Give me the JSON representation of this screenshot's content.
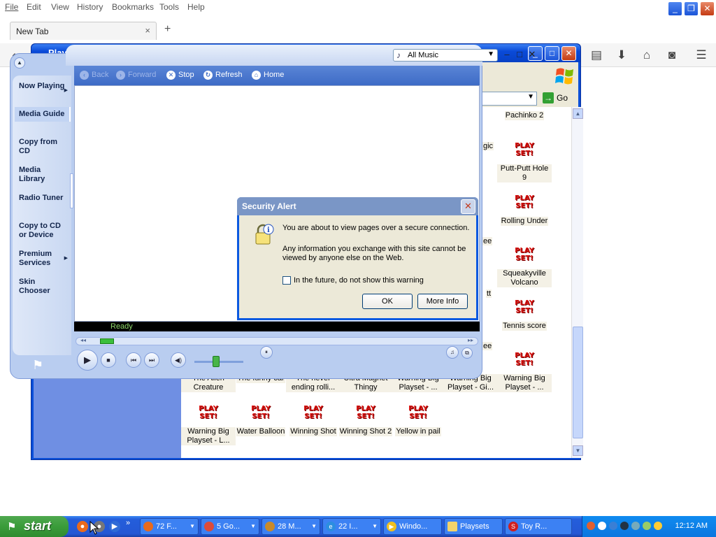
{
  "firefox": {
    "menu": [
      "File",
      "Edit",
      "View",
      "History",
      "Bookmarks",
      "Tools",
      "Help"
    ],
    "tab_title": "New Tab",
    "tab_close": "×",
    "new_tab": "+"
  },
  "explorer": {
    "title": "Playsets",
    "go_label": "Go",
    "files_right_col": [
      "Pachinko 2",
      "Putt-Putt Hole 9",
      "Rolling Under",
      "Squeakyville Volcano",
      "Tennis score",
      "Warning Big Playset - ..."
    ],
    "partial_labels": [
      "gic",
      "ee",
      "tt",
      "ee"
    ],
    "files_row_a": [
      "The Alien Creature",
      "The funny car",
      "The never ending rolli...",
      "Ultra Magnet Thingy",
      "Warning Big Playset - ...",
      "Warning Big Playset - Gi..."
    ],
    "files_row_b": [
      "Warning Big Playset - L...",
      "Water Balloon",
      "Winning Shot",
      "Winning Shot 2",
      "Yellow in pail"
    ],
    "icon_text": "PLAY SET!"
  },
  "wmp": {
    "library_select": "All Music",
    "nav_items": [
      {
        "label": "Now Playing",
        "arrow": "▶"
      },
      {
        "label": "Media Guide",
        "arrow": ""
      },
      {
        "label": "Copy from CD",
        "arrow": ""
      },
      {
        "label": "Media Library",
        "arrow": ""
      },
      {
        "label": "Radio Tuner",
        "arrow": ""
      },
      {
        "label": "Copy to CD or Device",
        "arrow": ""
      },
      {
        "label": "Premium Services",
        "arrow": "▶"
      },
      {
        "label": "Skin Chooser",
        "arrow": ""
      }
    ],
    "browser_nav": {
      "back": "Back",
      "forward": "Forward",
      "stop": "Stop",
      "refresh": "Refresh",
      "home": "Home"
    },
    "status": "Ready"
  },
  "dialog": {
    "title": "Security Alert",
    "line1": "You are about to view pages over a secure connection.",
    "line2": "Any information you exchange with this site cannot be viewed by anyone else on the Web.",
    "checkbox_label": "In the future, do not show this warning",
    "ok": "OK",
    "more_info": "More Info"
  },
  "taskbar": {
    "start": "start",
    "tasks": [
      "72 F...",
      "5 Go...",
      "28 M...",
      "22 I...",
      "Windo...",
      "Playsets",
      "Toy R..."
    ],
    "clock": "12:12 AM"
  }
}
